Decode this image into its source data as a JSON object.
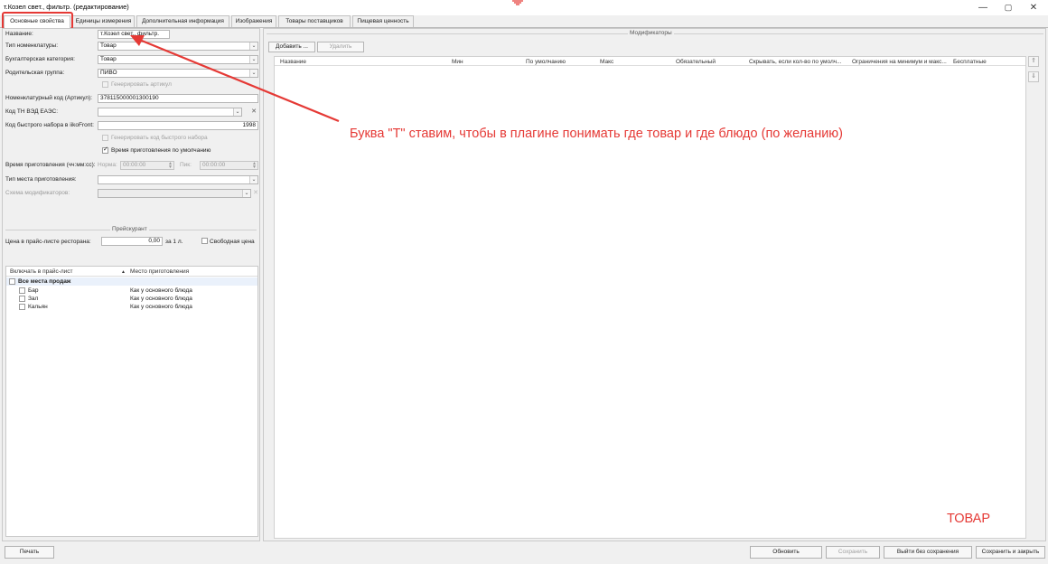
{
  "window": {
    "title": "т.Козел свет., фильтр. (редактирование)",
    "minimize": "—",
    "maximize": "▢",
    "close": "✕"
  },
  "tabs": [
    {
      "label": "Основные свойства"
    },
    {
      "label": "Единицы измерения"
    },
    {
      "label": "Дополнительная информация"
    },
    {
      "label": "Изображения"
    },
    {
      "label": "Товары поставщиков"
    },
    {
      "label": "Пищевая ценность"
    }
  ],
  "form": {
    "name_label": "Название:",
    "name_value": "т.Козел свет., фильтр.",
    "type_label": "Тип номенклатуры:",
    "type_value": "Товар",
    "acc_label": "Бухгалтерская категория:",
    "acc_value": "Товар",
    "parent_label": "Родительская группа:",
    "parent_value": "ПИВО",
    "gen_article": "Генерировать артикул",
    "article_label": "Номенклатурный код (Артикул):",
    "article_value": "378115000001300190",
    "tn_label": "Код ТН ВЭД ЕАЭС:",
    "quick_label": "Код быстрого набора в iikoFront:",
    "quick_value": "1998",
    "gen_quick": "Генерировать код быстрого набора",
    "default_time": "Время приготовления по умолчанию",
    "cook_time_label": "Время приготовления (чч:мм:сс):",
    "norm_label": "Норма:",
    "norm_value": "00:00:00",
    "peak_label": "Пик:",
    "peak_value": "00:00:00",
    "place_type_label": "Тип места приготовления:",
    "mod_scheme_label": "Схема модификаторов:"
  },
  "pricelist": {
    "title": "Прейскурант",
    "price_label": "Цена в прайс-листе ресторана:",
    "price_value": "0,00",
    "price_unit": "за 1 л.",
    "free_price": "Свободная цена",
    "col_include": "Включать в прайс-лист",
    "col_place": "Место приготовления",
    "rows": [
      {
        "name": "Все места продаж",
        "place": ""
      },
      {
        "name": "Бар",
        "place": "Как у основного блюда"
      },
      {
        "name": "Зал",
        "place": "Как у основного блюда"
      },
      {
        "name": "Кальян",
        "place": "Как у основного блюда"
      }
    ]
  },
  "modifiers": {
    "title": "Модификаторы",
    "add_button": "Добавить ...",
    "delete_button": "Удалить",
    "columns": [
      "Название",
      "Мин",
      "По умолчанию",
      "Макс",
      "Обязательный",
      "Скрывать, если кол-во по умолч...",
      "Ограничения на минимум и макс...",
      "Бесплатные"
    ]
  },
  "annotation": {
    "text": "Буква \"Т\" ставим, чтобы в плагине понимать где товар и где блюдо (по желанию)",
    "tovar": "ТОВАР",
    "color": "#e53935"
  },
  "footer": {
    "print": "Печать",
    "refresh": "Обновить",
    "save": "Сохранить",
    "exit_no_save": "Выйти без сохранения",
    "save_close": "Сохранить и закрыть"
  }
}
